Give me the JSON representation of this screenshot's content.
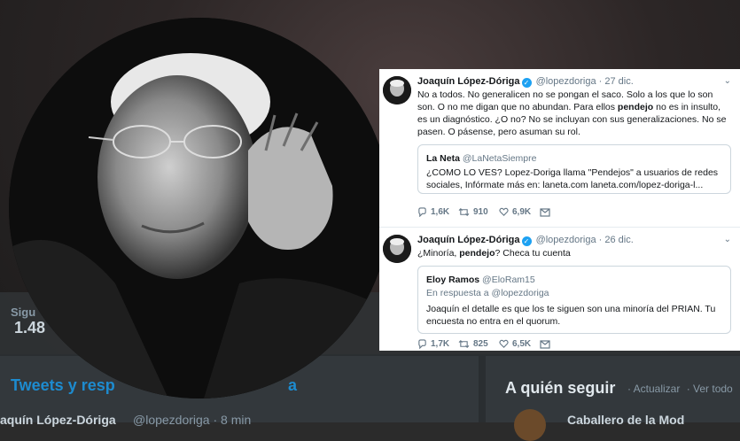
{
  "background": {
    "stat_label": "Sigu",
    "stat_value": "1.48",
    "tweets_tab": "Tweets y resp",
    "tweets_tab_right": "a",
    "who_to_follow": "A quién seguir",
    "who_links": [
      "· Actualizar",
      "· Ver todo"
    ],
    "bottom_name": "aquín López-Dóriga",
    "bottom_handle": "@lopezdoriga · 8 min",
    "bottom_right": "Caballero de la Mod"
  },
  "tweets": [
    {
      "name": "Joaquín López-Dóriga",
      "handle": "@lopezdoriga",
      "date": "· 27 dic.",
      "text_parts": [
        "No a todos. No generalicen no se pongan el saco. Solo a los que lo son son. O no me digan que no abundan. Para ellos ",
        "pendejo",
        " no es in insulto, es un diagnóstico. ¿O no? No se incluyan con sus generalizaciones. No se pasen. O pásense, pero asuman su rol."
      ],
      "quote": {
        "name": "La Neta",
        "handle": "@LaNetaSiempre",
        "text": "¿COMO LO VES? Lopez-Doriga llama \"Pendejos\" a usuarios de redes sociales, Infórmate más en: laneta.com laneta.com/lopez-doriga-l..."
      },
      "replies": "1,6K",
      "retweets": "910",
      "likes": "6,9K"
    },
    {
      "name": "Joaquín López-Dóriga",
      "handle": "@lopezdoriga",
      "date": "· 26 dic.",
      "text_parts": [
        "¿Minoría, ",
        "pendejo",
        "? Checa tu cuenta"
      ],
      "quote": {
        "name": "Eloy Ramos",
        "handle": "@EloRam15",
        "reply_to": "En respuesta a @lopezdoriga",
        "text": "Joaquín el detalle es que los te siguen son una minoría del PRIAN. Tu encuesta no entra en el quorum."
      },
      "replies": "1,7K",
      "retweets": "825",
      "likes": "6,5K"
    }
  ],
  "icons": {
    "verified": "verified-badge-icon",
    "chevron": "chevron-down-icon",
    "reply": "reply-icon",
    "retweet": "retweet-icon",
    "like": "heart-icon",
    "dm": "envelope-icon"
  },
  "colors": {
    "accent": "#1da1f2",
    "link": "#1b95e0",
    "muted": "#657786",
    "text": "#14171a"
  }
}
